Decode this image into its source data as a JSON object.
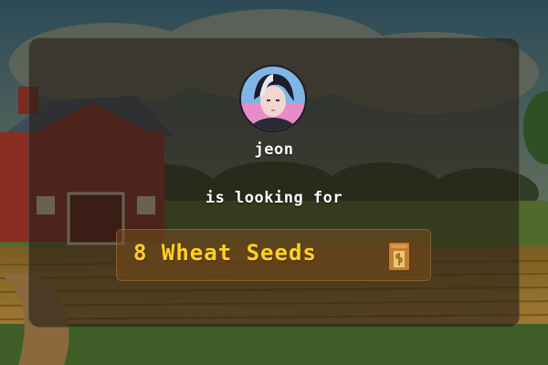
{
  "request": {
    "username": "jeon",
    "lead_text": "is looking for",
    "item_text": "8 Wheat Seeds"
  },
  "icons": {
    "avatar": "user-avatar-portrait",
    "item": "wheat-seed-packet-icon"
  },
  "colors": {
    "item_text": "#ffd21f",
    "card_bg": "#261e16",
    "badge_bg": "#784c1e",
    "text": "#ffffff"
  }
}
